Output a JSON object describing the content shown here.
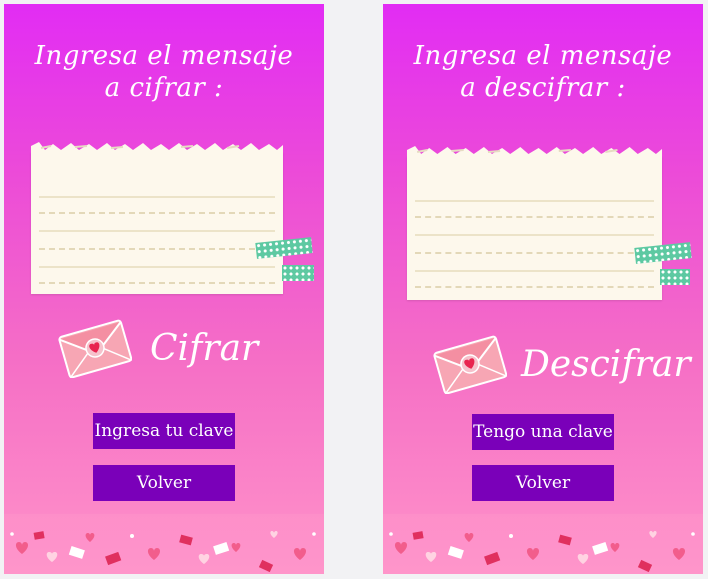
{
  "encrypt_screen": {
    "heading": "Ingresa el mensaje a cifrar :",
    "action_label": "Cifrar",
    "key_button": "Ingresa tu clave",
    "back_button": "Volver"
  },
  "decrypt_screen": {
    "heading": "Ingresa el mensaje a descifrar :",
    "action_label": "Descifrar",
    "key_button": "Tengo una clave",
    "back_button": "Volver"
  },
  "colors": {
    "gradient_top": "#e22cf4",
    "gradient_bottom": "#ff93c9",
    "button": "#7a00b9",
    "note_paper": "#fdf8ec",
    "tape": "#5dc9a2"
  },
  "icons": [
    "envelope-heart-icon",
    "washi-tape-icon",
    "hearts-decoration"
  ]
}
